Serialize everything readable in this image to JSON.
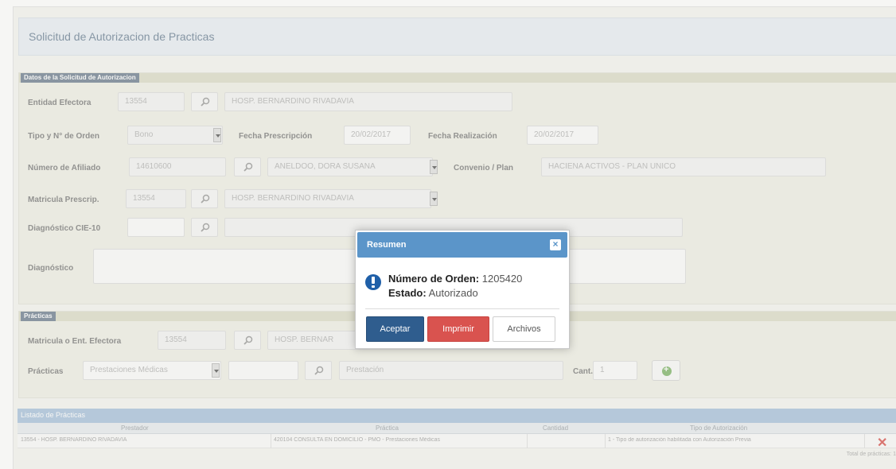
{
  "page": {
    "title": "Solicitud de Autorizacion de Practicas"
  },
  "solicitud": {
    "section_title": "Datos de la Solicitud de Autorizacion",
    "entidad": {
      "label": "Entidad Efectora",
      "code": "13554",
      "name": "HOSP. BERNARDINO RIVADAVIA"
    },
    "orden": {
      "label": "Tipo y N° de Orden",
      "tipo": "Bono"
    },
    "fecha_prescripcion": {
      "label": "Fecha Prescripción",
      "value": "20/02/2017"
    },
    "fecha_realizacion": {
      "label": "Fecha Realización",
      "value": "20/02/2017"
    },
    "afiliado": {
      "label": "Número de Afiliado",
      "number": "14610600",
      "name": "ANELDOO, DORA SUSANA"
    },
    "convenio": {
      "label": "Convenio / Plan",
      "value": "HACIENA ACTIVOS - PLAN UNICO"
    },
    "matricula": {
      "label": "Matricula Prescrip.",
      "code": "13554",
      "name": "HOSP. BERNARDINO RIVADAVIA"
    },
    "cie10": {
      "label": "Diagnóstico CIE-10"
    },
    "diagnostico": {
      "label": "Diagnóstico"
    }
  },
  "practicas": {
    "section_title": "Prácticas",
    "matricula": {
      "label": "Matricula o Ent. Efectora",
      "code": "13554",
      "name": "HOSP. BERNAR"
    },
    "practicas": {
      "label": "Prácticas",
      "select": "Prestaciones Médicas",
      "placeholder": "Prestación"
    },
    "cant": {
      "label": "Cant.",
      "value": "1"
    }
  },
  "grid": {
    "title": "Listado de Prácticas",
    "columns": [
      "Prestador",
      "Práctica",
      "Cantidad",
      "Tipo de Autorización"
    ],
    "rows": [
      [
        "13554 - HOSP. BERNARDINO RIVADAVIA",
        "420104 CONSULTA EN DOMICILIO - PMO - Prestaciones Médicas",
        "",
        "1 - Tipo de autorización habilitada con Autorización Previa"
      ]
    ],
    "footer": "Total de prácticas: 1"
  },
  "modal": {
    "title": "Resumen",
    "close_symbol": "×",
    "orden_label": "Número de Orden:",
    "orden_value": "1205420",
    "estado_label": "Estado:",
    "estado_value": "Autorizado",
    "accept": "Aceptar",
    "print": "Imprimir",
    "files": "Archivos"
  },
  "colors": {
    "modal_header": "#5b95c9",
    "accept": "#2f5d8e",
    "print": "#d9534f",
    "info_icon": "#1f5fa8"
  }
}
